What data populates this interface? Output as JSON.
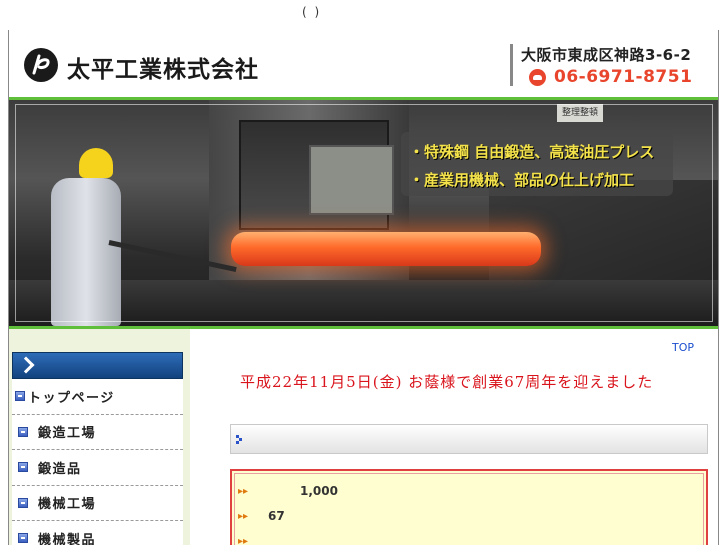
{
  "top_note": "(   )",
  "header": {
    "company_name": "太平工業株式会社",
    "address": "大阪市東成区神路3-6-2",
    "tel": "06-6971-8751",
    "logo_icon": "company-logo-icon",
    "tel_icon": "telephone-icon",
    "tel_color": "#e8452c"
  },
  "hero": {
    "caption_line1": "・特殊鋼 自由鍛造、高速油圧プレス",
    "caption_line2": "・産業用機械、部品の仕上げ加工",
    "sign_text": "整理整頓",
    "caption_color": "#f3e24a"
  },
  "sidebar": {
    "header_icon": "chevron-right-icon",
    "items": [
      {
        "label": "トップページ"
      },
      {
        "label": "鍛造工場"
      },
      {
        "label": "鍛造品"
      },
      {
        "label": "機械工場"
      },
      {
        "label": "機械製品"
      }
    ]
  },
  "main": {
    "top_link": "TOP",
    "anniversary": "平成22年11月5日(金) お蔭様で創業67周年を迎えました",
    "info_rows": [
      {
        "value": "1,000"
      },
      {
        "value": "67"
      },
      {
        "value": ""
      }
    ]
  },
  "colors": {
    "accent_green": "#5fbf3a",
    "sidebar_bg": "#eef3dd",
    "nav_blue": "#12427e",
    "alert_red": "#d9141c"
  }
}
